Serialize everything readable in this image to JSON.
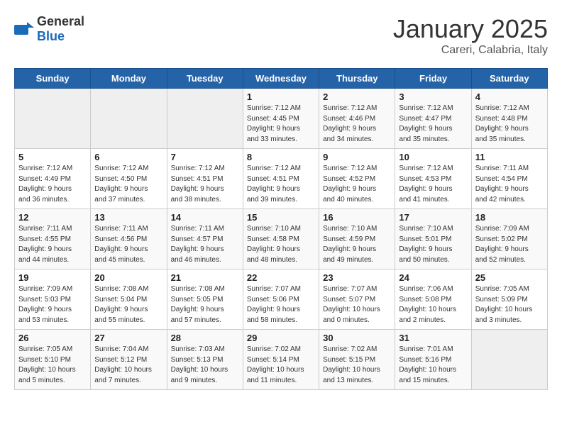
{
  "logo": {
    "general": "General",
    "blue": "Blue"
  },
  "title": "January 2025",
  "subtitle": "Careri, Calabria, Italy",
  "days_of_week": [
    "Sunday",
    "Monday",
    "Tuesday",
    "Wednesday",
    "Thursday",
    "Friday",
    "Saturday"
  ],
  "weeks": [
    [
      {
        "day": "",
        "info": ""
      },
      {
        "day": "",
        "info": ""
      },
      {
        "day": "",
        "info": ""
      },
      {
        "day": "1",
        "info": "Sunrise: 7:12 AM\nSunset: 4:45 PM\nDaylight: 9 hours\nand 33 minutes."
      },
      {
        "day": "2",
        "info": "Sunrise: 7:12 AM\nSunset: 4:46 PM\nDaylight: 9 hours\nand 34 minutes."
      },
      {
        "day": "3",
        "info": "Sunrise: 7:12 AM\nSunset: 4:47 PM\nDaylight: 9 hours\nand 35 minutes."
      },
      {
        "day": "4",
        "info": "Sunrise: 7:12 AM\nSunset: 4:48 PM\nDaylight: 9 hours\nand 35 minutes."
      }
    ],
    [
      {
        "day": "5",
        "info": "Sunrise: 7:12 AM\nSunset: 4:49 PM\nDaylight: 9 hours\nand 36 minutes."
      },
      {
        "day": "6",
        "info": "Sunrise: 7:12 AM\nSunset: 4:50 PM\nDaylight: 9 hours\nand 37 minutes."
      },
      {
        "day": "7",
        "info": "Sunrise: 7:12 AM\nSunset: 4:51 PM\nDaylight: 9 hours\nand 38 minutes."
      },
      {
        "day": "8",
        "info": "Sunrise: 7:12 AM\nSunset: 4:51 PM\nDaylight: 9 hours\nand 39 minutes."
      },
      {
        "day": "9",
        "info": "Sunrise: 7:12 AM\nSunset: 4:52 PM\nDaylight: 9 hours\nand 40 minutes."
      },
      {
        "day": "10",
        "info": "Sunrise: 7:12 AM\nSunset: 4:53 PM\nDaylight: 9 hours\nand 41 minutes."
      },
      {
        "day": "11",
        "info": "Sunrise: 7:11 AM\nSunset: 4:54 PM\nDaylight: 9 hours\nand 42 minutes."
      }
    ],
    [
      {
        "day": "12",
        "info": "Sunrise: 7:11 AM\nSunset: 4:55 PM\nDaylight: 9 hours\nand 44 minutes."
      },
      {
        "day": "13",
        "info": "Sunrise: 7:11 AM\nSunset: 4:56 PM\nDaylight: 9 hours\nand 45 minutes."
      },
      {
        "day": "14",
        "info": "Sunrise: 7:11 AM\nSunset: 4:57 PM\nDaylight: 9 hours\nand 46 minutes."
      },
      {
        "day": "15",
        "info": "Sunrise: 7:10 AM\nSunset: 4:58 PM\nDaylight: 9 hours\nand 48 minutes."
      },
      {
        "day": "16",
        "info": "Sunrise: 7:10 AM\nSunset: 4:59 PM\nDaylight: 9 hours\nand 49 minutes."
      },
      {
        "day": "17",
        "info": "Sunrise: 7:10 AM\nSunset: 5:01 PM\nDaylight: 9 hours\nand 50 minutes."
      },
      {
        "day": "18",
        "info": "Sunrise: 7:09 AM\nSunset: 5:02 PM\nDaylight: 9 hours\nand 52 minutes."
      }
    ],
    [
      {
        "day": "19",
        "info": "Sunrise: 7:09 AM\nSunset: 5:03 PM\nDaylight: 9 hours\nand 53 minutes."
      },
      {
        "day": "20",
        "info": "Sunrise: 7:08 AM\nSunset: 5:04 PM\nDaylight: 9 hours\nand 55 minutes."
      },
      {
        "day": "21",
        "info": "Sunrise: 7:08 AM\nSunset: 5:05 PM\nDaylight: 9 hours\nand 57 minutes."
      },
      {
        "day": "22",
        "info": "Sunrise: 7:07 AM\nSunset: 5:06 PM\nDaylight: 9 hours\nand 58 minutes."
      },
      {
        "day": "23",
        "info": "Sunrise: 7:07 AM\nSunset: 5:07 PM\nDaylight: 10 hours\nand 0 minutes."
      },
      {
        "day": "24",
        "info": "Sunrise: 7:06 AM\nSunset: 5:08 PM\nDaylight: 10 hours\nand 2 minutes."
      },
      {
        "day": "25",
        "info": "Sunrise: 7:05 AM\nSunset: 5:09 PM\nDaylight: 10 hours\nand 3 minutes."
      }
    ],
    [
      {
        "day": "26",
        "info": "Sunrise: 7:05 AM\nSunset: 5:10 PM\nDaylight: 10 hours\nand 5 minutes."
      },
      {
        "day": "27",
        "info": "Sunrise: 7:04 AM\nSunset: 5:12 PM\nDaylight: 10 hours\nand 7 minutes."
      },
      {
        "day": "28",
        "info": "Sunrise: 7:03 AM\nSunset: 5:13 PM\nDaylight: 10 hours\nand 9 minutes."
      },
      {
        "day": "29",
        "info": "Sunrise: 7:02 AM\nSunset: 5:14 PM\nDaylight: 10 hours\nand 11 minutes."
      },
      {
        "day": "30",
        "info": "Sunrise: 7:02 AM\nSunset: 5:15 PM\nDaylight: 10 hours\nand 13 minutes."
      },
      {
        "day": "31",
        "info": "Sunrise: 7:01 AM\nSunset: 5:16 PM\nDaylight: 10 hours\nand 15 minutes."
      },
      {
        "day": "",
        "info": ""
      }
    ]
  ]
}
